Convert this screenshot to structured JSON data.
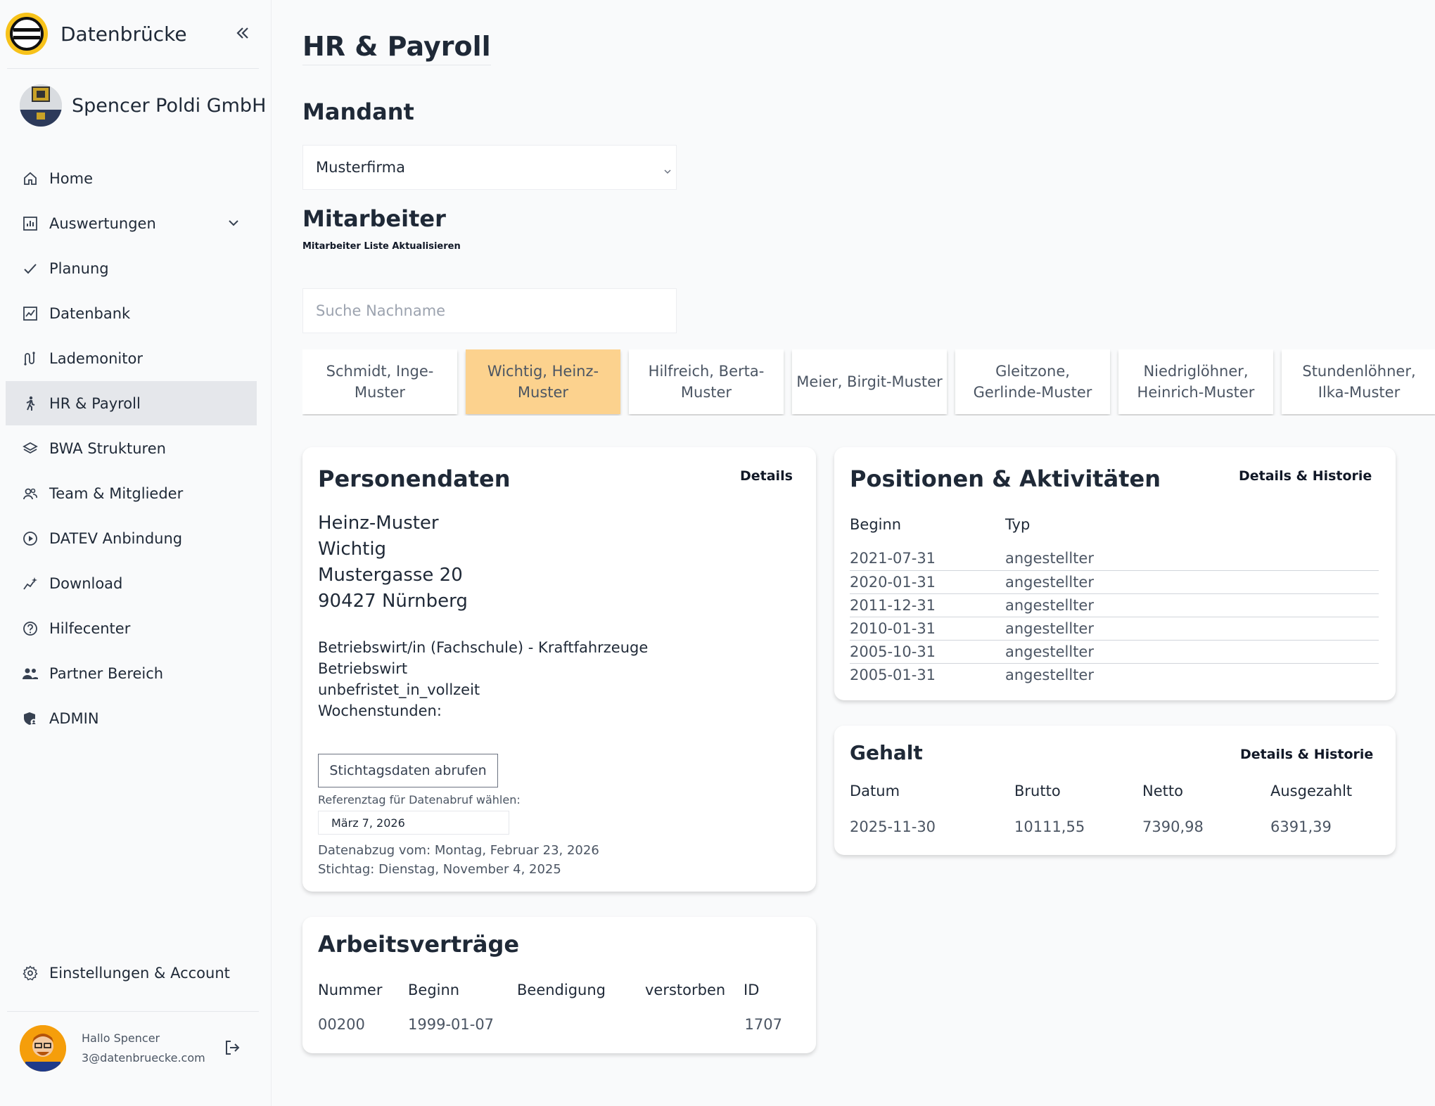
{
  "app": {
    "brand_name": "Datenbrücke",
    "org_name": "Spencer Poldi GmbH"
  },
  "sidebar": {
    "items": [
      {
        "label": "Home",
        "icon": "home-icon"
      },
      {
        "label": "Auswertungen",
        "icon": "chart-icon"
      },
      {
        "label": "Planung",
        "icon": "check-icon"
      },
      {
        "label": "Datenbank",
        "icon": "database-icon"
      },
      {
        "label": "Lademonitor",
        "icon": "monitor-icon"
      },
      {
        "label": "HR & Payroll",
        "icon": "person-walking-icon"
      },
      {
        "label": "BWA Strukturen",
        "icon": "layers-icon"
      },
      {
        "label": "Team & Mitglieder",
        "icon": "team-icon"
      },
      {
        "label": "DATEV Anbindung",
        "icon": "play-circle-icon"
      },
      {
        "label": "Download",
        "icon": "sparkle-chart-icon"
      },
      {
        "label": "Hilfecenter",
        "icon": "help-icon"
      },
      {
        "label": "Partner Bereich",
        "icon": "partner-icon"
      },
      {
        "label": "ADMIN",
        "icon": "shield-user-icon"
      }
    ],
    "settings_label": "Einstellungen & Account",
    "user_greeting": "Hallo Spencer",
    "user_email": "3@datenbruecke.com"
  },
  "main": {
    "title": "HR & Payroll",
    "mandant_heading": "Mandant",
    "mandant_value": "Musterfirma",
    "employees_heading": "Mitarbeiter",
    "refresh_label": "Mitarbeiter Liste Aktualisieren",
    "search_placeholder": "Suche Nachname",
    "employees": [
      "Schmidt, Inge-Muster",
      "Wichtig, Heinz-Muster",
      "Hilfreich, Berta-Muster",
      "Meier, Birgit-Muster",
      "Gleitzone, Gerlinde-Muster",
      "Niedriglöhner, Heinrich-Muster",
      "Stundenlöhner, Ilka-Muster"
    ]
  },
  "person": {
    "title": "Personendaten",
    "details_label": "Details",
    "first_name": "Heinz-Muster",
    "last_name": "Wichtig",
    "street": "Mustergasse 20",
    "city": "90427 Nürnberg",
    "education": "Betriebswirt/in (Fachschule) - Kraftfahrzeuge",
    "job_title": "Betriebswirt",
    "contract_type": "unbefristet_in_vollzeit",
    "weekly_hours_label": "Wochenstunden:",
    "button_label": "Stichtagsdaten abrufen",
    "ref_label": "Referenztag für Datenabruf wählen:",
    "ref_date": "März 7, 2026",
    "data_pull": "Datenabzug vom: Montag, Februar 23, 2026",
    "cutoff": "Stichtag: Dienstag, November 4, 2025"
  },
  "contracts": {
    "title": "Arbeitsverträge",
    "columns": [
      "Nummer",
      "Beginn",
      "Beendigung",
      "verstorben",
      "ID"
    ],
    "rows": [
      [
        "00200",
        "1999-01-07",
        "",
        "",
        "1707"
      ]
    ]
  },
  "positions": {
    "title": "Positionen & Aktivitäten",
    "details_label": "Details & Historie",
    "columns": [
      "Beginn",
      "Typ"
    ],
    "rows": [
      [
        "2021-07-31",
        "angestellter"
      ],
      [
        "2020-01-31",
        "angestellter"
      ],
      [
        "2011-12-31",
        "angestellter"
      ],
      [
        "2010-01-31",
        "angestellter"
      ],
      [
        "2005-10-31",
        "angestellter"
      ],
      [
        "2005-01-31",
        "angestellter"
      ]
    ]
  },
  "salary": {
    "title": "Gehalt",
    "details_label": "Details & Historie",
    "columns": [
      "Datum",
      "Brutto",
      "Netto",
      "Ausgezahlt"
    ],
    "rows": [
      [
        "2025-11-30",
        "10111,55",
        "7390,98",
        "6391,39"
      ]
    ]
  },
  "colors": {
    "active_tab": "#fcd28e",
    "brand_yellow": "#f7c21a",
    "active_nav": "#e5e7eb"
  }
}
